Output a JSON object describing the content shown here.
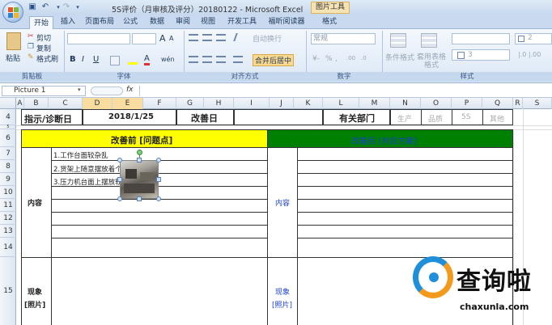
{
  "window": {
    "title": "5S评价（月审核及评分）20180122 - Microsoft Excel",
    "context_tab": "图片工具"
  },
  "tabs": [
    "开始",
    "插入",
    "页面布局",
    "公式",
    "数据",
    "审阅",
    "视图",
    "开发工具",
    "福昕阅读器",
    "格式"
  ],
  "ribbon": {
    "clipboard": {
      "paste": "粘贴",
      "cut": "剪切",
      "copy": "复制",
      "format_painter": "格式刷",
      "label": "剪贴板"
    },
    "font": {
      "label": "字体",
      "grow": "A",
      "shrink": "A",
      "bold": "B",
      "italic": "I",
      "underline": "U",
      "change_case": "wén"
    },
    "alignment": {
      "label": "对齐方式",
      "wrap": "自动换行",
      "merge": "合并后居中"
    },
    "number": {
      "label": "数字",
      "format": "常规",
      "percent": "%"
    },
    "styles": {
      "conditional": "条件格式",
      "table_format": "套用表格格式",
      "label": "样式"
    },
    "right": {
      "v2": "2",
      "v3": "3"
    }
  },
  "formula_bar": {
    "name_box": "Picture 1",
    "fx": "fx"
  },
  "columns": [
    "A",
    "B",
    "C",
    "D",
    "E",
    "F",
    "G",
    "H",
    "I",
    "J",
    "K",
    "L",
    "M",
    "N",
    "O",
    "P",
    "Q",
    "R",
    "S"
  ],
  "rows": [
    "4",
    "5",
    "6",
    "7",
    "8",
    "9",
    "10",
    "11",
    "12",
    "13",
    "14",
    "15"
  ],
  "sheet": {
    "label_indicator": "指示/诊断日",
    "date": "2018/1/25",
    "improve_date": "改善日",
    "dept": "有关部门",
    "dept_options": [
      "生产",
      "品质",
      "5S",
      "其他"
    ],
    "before_header": "改善前 [问题点]",
    "after_header": "改善后 [对应方案]",
    "content": "内容",
    "issues": [
      "1.工作台面较杂乱",
      "2.货架上随意摆放着个",
      "3.压力机台面上摆放较"
    ],
    "phenomenon": "现象",
    "photo": "[照片]"
  },
  "watermark": {
    "text": "查询啦",
    "domain": "chaxunla.com"
  }
}
